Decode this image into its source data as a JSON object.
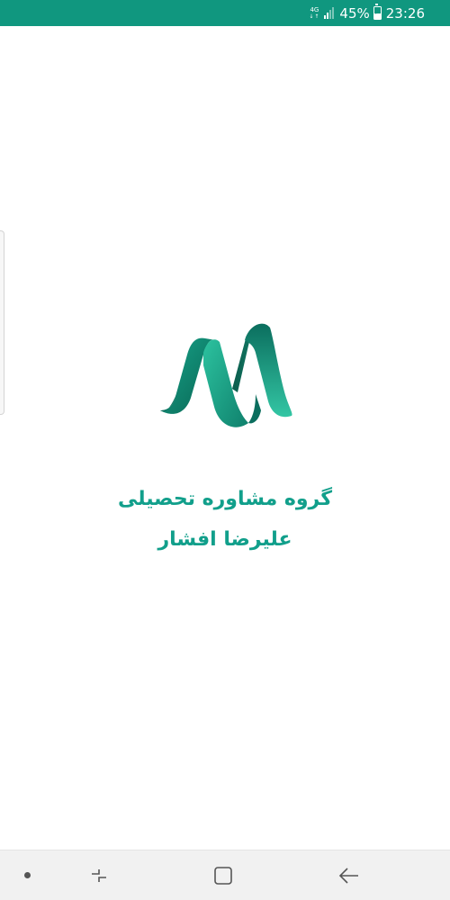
{
  "status_bar": {
    "network_type": "4G",
    "network_arrows": "↓↑",
    "signal_bars_filled": 2,
    "signal_bars_total": 4,
    "battery_percent_label": "45%",
    "battery_level": 0.45,
    "time": "23:26"
  },
  "splash": {
    "title_line_1": "گروه مشاوره تحصیلی",
    "title_line_2": "علیرضا افشار"
  },
  "colors": {
    "status_bar": "#10977f",
    "brand_text": "#119f8b",
    "logo_dark": "#0b6e5e",
    "logo_light": "#2bbf9f"
  },
  "nav_bar": {
    "buttons": [
      "recents-icon",
      "home-icon",
      "back-icon"
    ]
  }
}
